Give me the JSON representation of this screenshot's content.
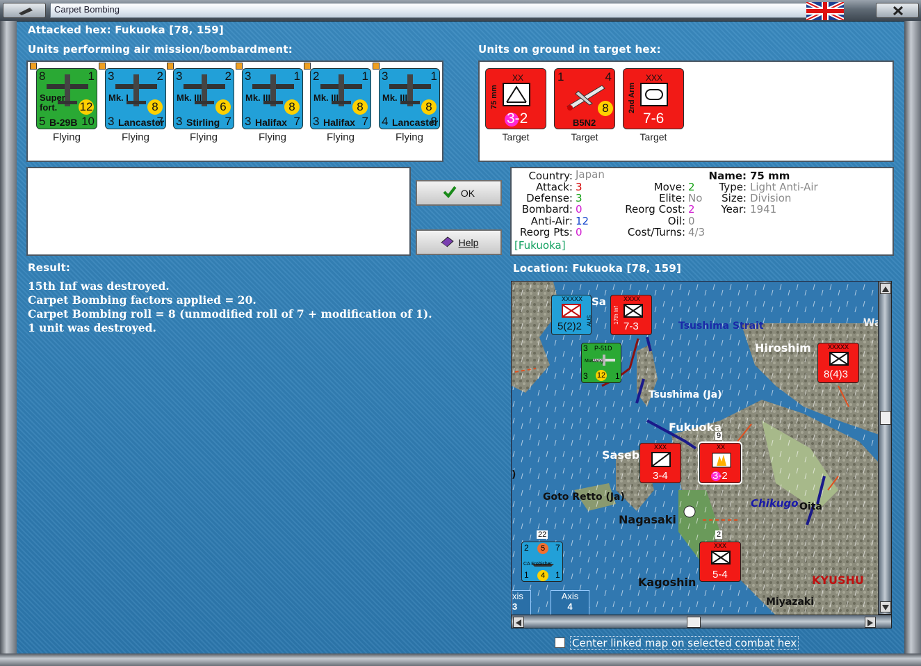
{
  "window": {
    "title": "Carpet Bombing"
  },
  "header": {
    "attacked_hex": "Attacked hex: Fukuoka  [78, 159]",
    "air_units_label": "Units performing air mission/bombardment:",
    "ground_units_label": "Units on ground in target hex:"
  },
  "air_units": [
    {
      "top_left": "8",
      "top_right": "1",
      "name1": "Super",
      "name2": "fort.",
      "badge": "12",
      "bottom_left": "5",
      "bottom_name": "B-29B",
      "bottom_right": "10",
      "status": "Flying",
      "color": "#2aa934"
    },
    {
      "top_left": "3",
      "top_right": "2",
      "name1": "Mk. I",
      "name2": "",
      "badge": "8",
      "bottom_left": "3",
      "bottom_name": "Lancaster",
      "bottom_right": "7",
      "status": "Flying",
      "color": "#22a0d8"
    },
    {
      "top_left": "3",
      "top_right": "2",
      "name1": "Mk. III",
      "name2": "",
      "badge": "6",
      "bottom_left": "3",
      "bottom_name": "Stirling",
      "bottom_right": "7",
      "status": "Flying",
      "color": "#22a0d8"
    },
    {
      "top_left": "3",
      "top_right": "1",
      "name1": "Mk. III",
      "name2": "",
      "badge": "8",
      "bottom_left": "3",
      "bottom_name": "Halifax",
      "bottom_right": "7",
      "status": "Flying",
      "color": "#22a0d8"
    },
    {
      "top_left": "2",
      "top_right": "1",
      "name1": "Mk. III",
      "name2": "",
      "badge": "8",
      "bottom_left": "3",
      "bottom_name": "Halifax",
      "bottom_right": "7",
      "status": "Flying",
      "color": "#22a0d8"
    },
    {
      "top_left": "3",
      "top_right": "1",
      "name1": "Mk. III",
      "name2": "",
      "badge": "8",
      "bottom_left": "4",
      "bottom_name": "Lancaster",
      "bottom_right": "8",
      "status": "Flying",
      "color": "#22a0d8"
    }
  ],
  "ground_units": [
    {
      "size": "XX",
      "side": "75 mm",
      "strength": "3-2",
      "status": "Target",
      "type": "aa"
    },
    {
      "top_left": "1",
      "top_right": "4",
      "badge": "8",
      "name": "B5N2",
      "status": "Target",
      "type": "air"
    },
    {
      "size": "XXX",
      "side": "2nd Arm",
      "strength": "7-6",
      "status": "Target",
      "type": "armor"
    }
  ],
  "buttons": {
    "ok": "OK",
    "help": "Help"
  },
  "unit_info": {
    "country_k": "Country:",
    "country_v": "Japan",
    "attack_k": "Attack:",
    "attack_v": "3",
    "defense_k": "Defense:",
    "defense_v": "3",
    "bombard_k": "Bombard:",
    "bombard_v": "0",
    "antiair_k": "Anti-Air:",
    "antiair_v": "12",
    "reorgpts_k": "Reorg Pts:",
    "reorgpts_v": "0",
    "hex": "[Fukuoka]",
    "move_k": "Move:",
    "move_v": "2",
    "elite_k": "Elite:",
    "elite_v": "No",
    "reorgcost_k": "Reorg Cost:",
    "reorgcost_v": "2",
    "oil_k": "Oil:",
    "oil_v": "0",
    "costturns_k": "Cost/Turns:",
    "costturns_v": "4/3",
    "name_k": "Name:",
    "name_v": "75 mm",
    "type_k": "Type:",
    "type_v": "Light Anti-Air",
    "size_k": "Size:",
    "size_v": "Division",
    "year_k": "Year:",
    "year_v": "1941"
  },
  "result": {
    "label": "Result:",
    "lines": [
      "15th Inf was destroyed.",
      "Carpet Bombing factors applied = 20.",
      "Carpet Bombing roll = 8 (unmodified roll of 7 + modification of 1).",
      "1 unit was destroyed."
    ]
  },
  "location": {
    "label": "Location:  Fukuoka  [78, 159]"
  },
  "map": {
    "labels": {
      "tsushima_strait": "Tsushima Strait",
      "hiroshima": "Hiroshim",
      "tsushima": "Tsushima (Ja)",
      "fukuoka": "Fukuoka",
      "sasebo": "Saseb",
      "goto": "Goto Retto (Ja)",
      "nagasaki": "Nagasaki",
      "chikugo": "Chikugo",
      "oita": "Oita",
      "kagoshima": "Kagoshin",
      "kyushu": "KYUSHU",
      "miyazaki": "Miyazaki",
      "wa": "Wa",
      "sa": "Sa"
    },
    "counters": {
      "aus_top": "XXXXX",
      "aus_str": "5(2)2",
      "aus_side": "AUS",
      "inf17_top": "XXXX",
      "inf17_str": "7-3",
      "inf17_side": "17th Inf",
      "mustang_tl": "3",
      "mustang_name": "P-51D",
      "mustang_sub": "Mustang",
      "mustang_bl": "3",
      "mustang_badge": "12",
      "mustang_br": "1",
      "right_top": "XXXXX",
      "right_str": "8(4)3",
      "chikugo_top": "XXX",
      "chikugo_str": "3-4",
      "fuk_top": "XX",
      "fuk_str": "3-2",
      "fuk_stack": "9",
      "kag_top": "XXX",
      "kag_str": "5-4",
      "kag_stack": "2",
      "ship_stack": "22",
      "ship_tl": "2",
      "ship_badge": "5",
      "ship_tr": "7",
      "ship_name": "CA Frobisher",
      "ship_bl": "1",
      "ship_badge2": "4",
      "ship_br": "1"
    },
    "tabs": [
      {
        "label": "xis",
        "num": "3"
      },
      {
        "label": "Axis",
        "num": "4"
      }
    ]
  },
  "center_map_checkbox": {
    "label": "Center linked map on selected combat hex",
    "checked": false
  },
  "colors": {
    "background": "#2f7fb4",
    "axis_red": "#f21a16",
    "allied_blue": "#22a0d8",
    "us_green": "#2aa934",
    "badge_yellow": "#ffd000"
  }
}
